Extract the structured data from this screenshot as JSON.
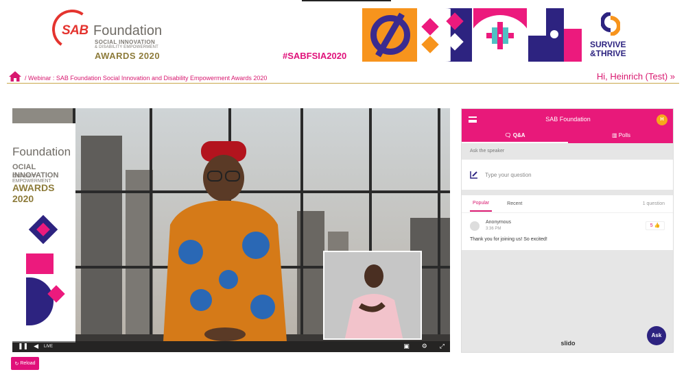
{
  "header": {
    "logo": {
      "sab": "SAB",
      "foundation": "Foundation",
      "line1": "SOCIAL INNOVATION",
      "line2": "& DISABILITY EMPOWERMENT",
      "awards": "AWARDS 2020"
    },
    "hashtag": "#SABFSIA2020",
    "survive_line1": "SURVIVE",
    "survive_line2": "&THRIVE"
  },
  "breadcrumb": {
    "home_icon": "home-icon",
    "text": "/ Webinar : SAB Foundation Social Innovation and Disability Empowerment Awards 2020"
  },
  "user": {
    "greeting": "Hi, Heinrich (Test) »"
  },
  "video": {
    "standee": {
      "line1": "Foundation",
      "line2": "OCIAL INNOVATION",
      "line3": "DISABILITY EMPOWERMENT",
      "line4": "AWARDS 2020"
    },
    "controls": {
      "pause_icon": "pause-icon",
      "volume_icon": "volume-icon",
      "live_label": "LIVE",
      "pip_icon": "picture-in-picture-icon",
      "settings_icon": "gear-icon",
      "fullscreen_icon": "fullscreen-icon"
    }
  },
  "reload_button": {
    "label": "Reload",
    "icon": "refresh-icon"
  },
  "slido": {
    "title": "SAB Foundation",
    "avatar_initial": "H",
    "tabs": [
      {
        "label": "Q&A",
        "icon": "qa-icon",
        "active": true
      },
      {
        "label": "Polls",
        "icon": "bar-chart-icon",
        "active": false
      }
    ],
    "ask_label": "Ask the speaker",
    "input_placeholder": "Type your question",
    "list_tabs": [
      "Popular",
      "Recent"
    ],
    "question_count": "1 question",
    "questions": [
      {
        "author": "Anonymous",
        "time": "3:36 PM",
        "likes": "5",
        "text": "Thank you for joining us! So excited!"
      }
    ],
    "brand": "slido",
    "ask_button": "Ask"
  },
  "colors": {
    "accent_pink": "#e0117a",
    "slido_pink": "#e8197a",
    "navy": "#2d2380",
    "gold_rule": "#c9a74a",
    "orange": "#f7941d"
  }
}
